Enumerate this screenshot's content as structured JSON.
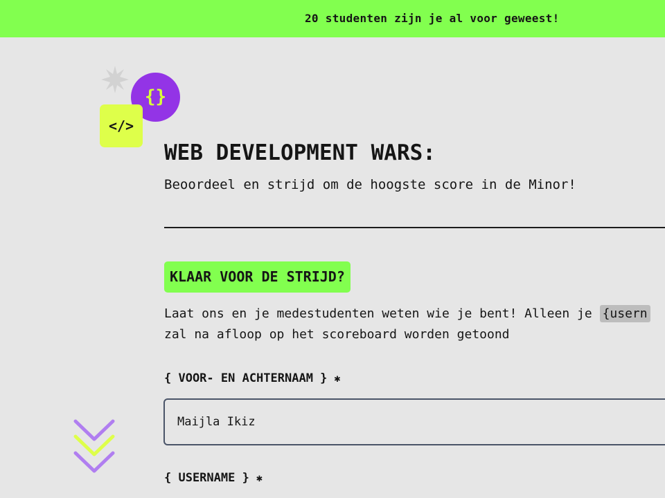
{
  "banner": {
    "text": "20 studenten zijn je al voor geweest!"
  },
  "badges": {
    "braces": "{}",
    "code": "</>"
  },
  "header": {
    "title": "WEB DEVELOPMENT WARS:",
    "subtitle": "Beoordeel en strijd om de hoogste score in de Minor!"
  },
  "section": {
    "heading": "KLAAR VOOR DE STRIJD?",
    "intro_before": "Laat ons en je medestudenten weten wie je bent! Alleen je",
    "intro_code": "{usern",
    "intro_after": "zal na afloop op het scoreboard worden getoond"
  },
  "form": {
    "name": {
      "label": "{ VOOR- EN ACHTERNAAM }",
      "required_mark": "✱",
      "value": "Maijla Ikiz"
    },
    "username": {
      "label": "{ USERNAME }",
      "required_mark": "✱"
    }
  },
  "colors": {
    "banner_green": "#82ff4f",
    "purple": "#9334e6",
    "lime": "#deff4a",
    "background": "#e6e6e6"
  }
}
